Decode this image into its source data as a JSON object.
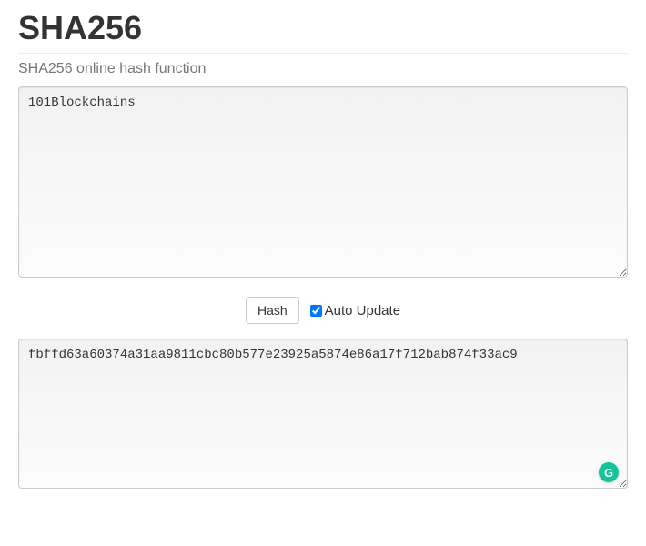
{
  "header": {
    "title": "SHA256",
    "subtitle": "SHA256 online hash function"
  },
  "input": {
    "value": "101Blockchains"
  },
  "controls": {
    "hash_button_label": "Hash",
    "auto_update_label": "Auto Update",
    "auto_update_checked": true
  },
  "output": {
    "value": "fbffd63a60374a31aa9811cbc80b577e23925a5874e86a17f712bab874f33ac9"
  },
  "badge": {
    "letter": "G"
  }
}
